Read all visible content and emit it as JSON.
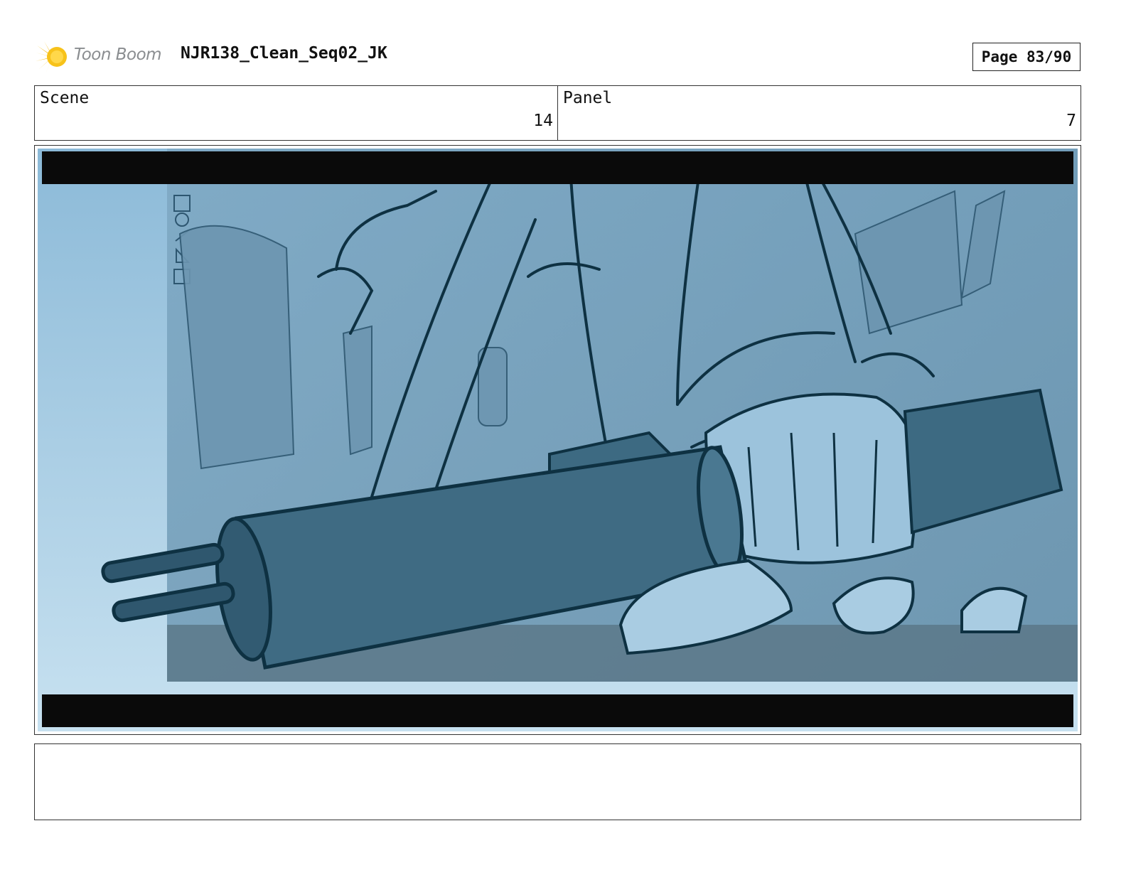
{
  "header": {
    "logo_text": "Toon Boom",
    "title": "NJR138_Clean_Seq02_JK",
    "page": "Page 83/90"
  },
  "info": {
    "scene_label": "Scene",
    "scene_value": "14",
    "panel_label": "Panel",
    "panel_value": "7"
  },
  "panel": {
    "description_icon": "storyboard-sketch-hand-gripping-cylinder-device"
  },
  "notes": {
    "text": ""
  },
  "colors": {
    "logo_star": "#f5b800",
    "sketch_bg": "#8fb9d6",
    "sketch_line": "#0e3142",
    "letterbox": "#0a0a0a"
  }
}
